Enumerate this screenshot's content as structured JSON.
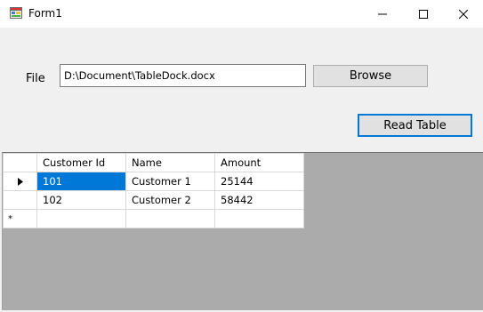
{
  "window": {
    "title": "Form1",
    "icon": "winforms-app-icon"
  },
  "form": {
    "file_label": "File",
    "file_path_value": "D:\\Document\\TableDock.docx",
    "browse_label": "Browse",
    "read_table_label": "Read Table"
  },
  "grid": {
    "columns": [
      "Customer Id",
      "Name",
      "Amount"
    ],
    "rows": [
      {
        "customer_id": "101",
        "name": "Customer 1",
        "amount": "25144"
      },
      {
        "customer_id": "102",
        "name": "Customer 2",
        "amount": "58442"
      }
    ],
    "current_row_indicator": "triangle-arrow-icon",
    "new_row_indicator": "*",
    "selected_cell": "Customer Id, row 1"
  },
  "colors": {
    "selection": "#0078d7",
    "grid_background": "#ababab",
    "form_background": "#f0f0f0"
  }
}
